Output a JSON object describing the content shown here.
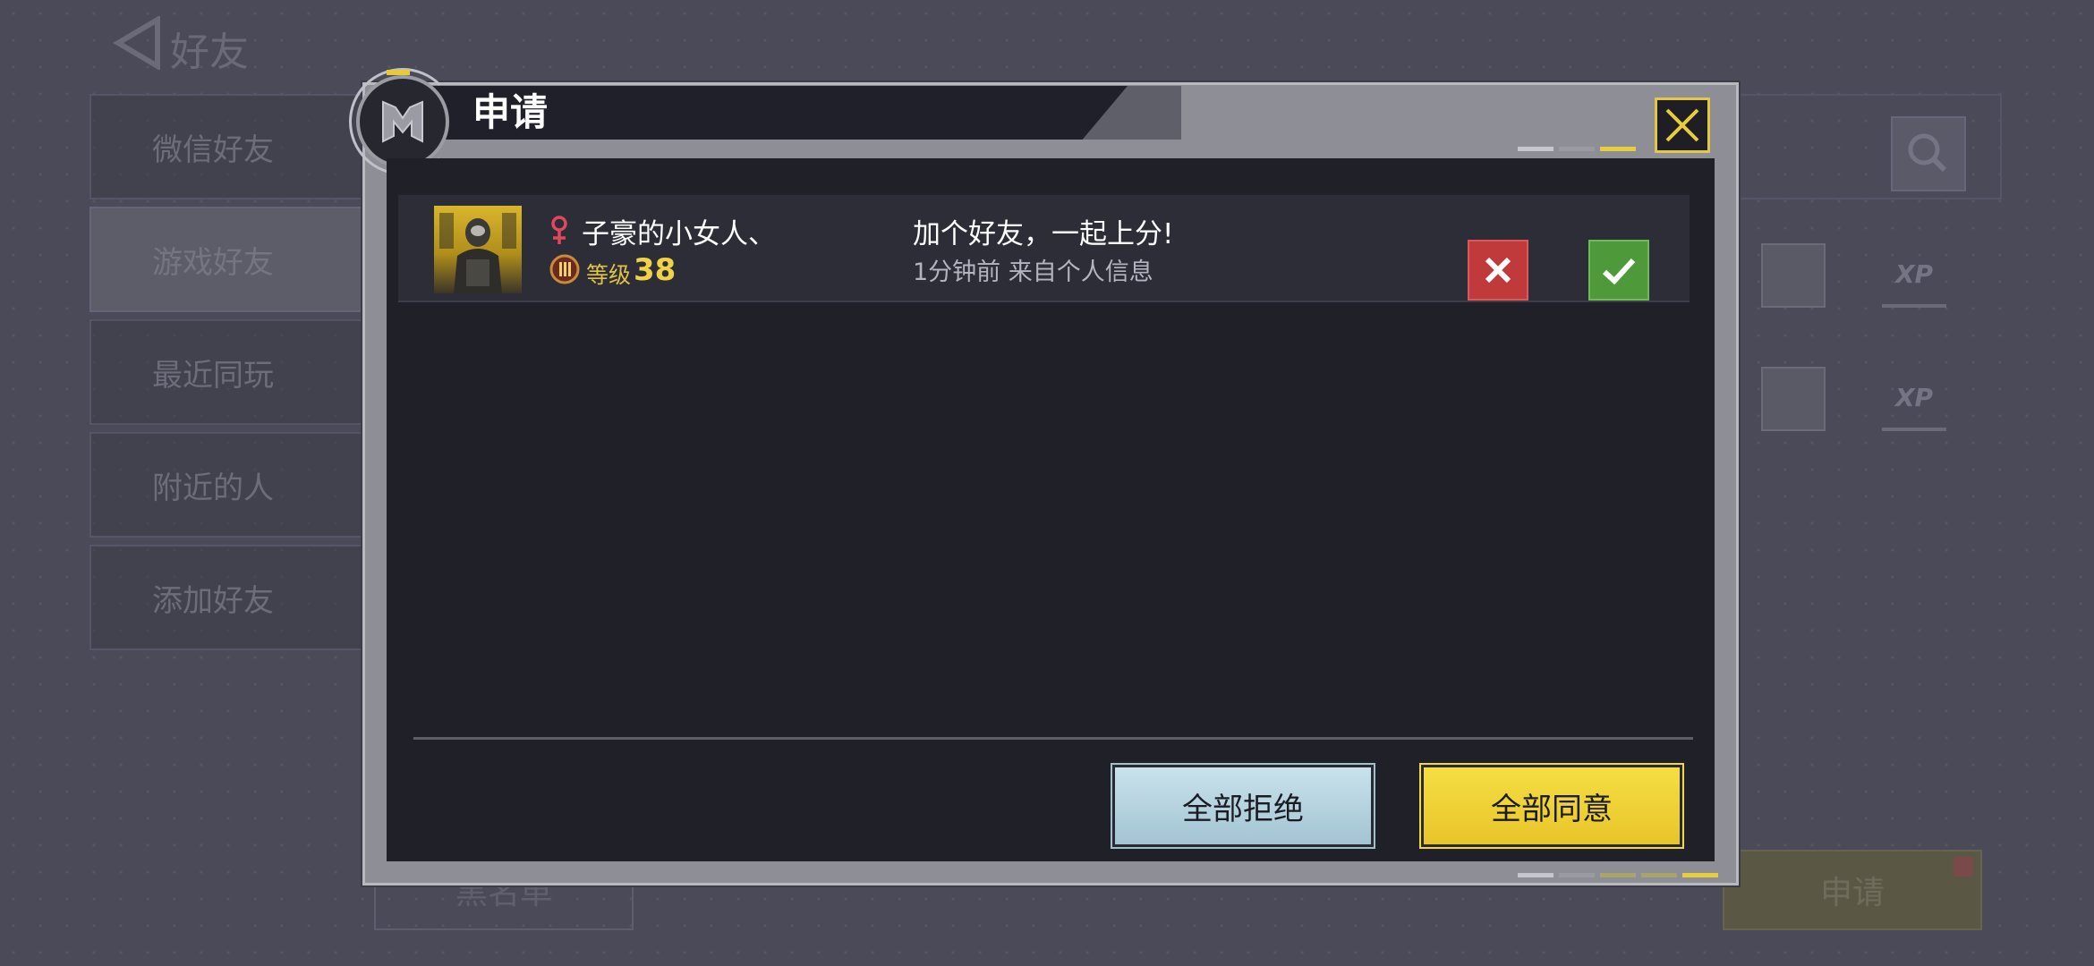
{
  "background": {
    "title": "好友",
    "side_tabs": [
      "微信好友",
      "游戏好友",
      "最近同玩",
      "附近的人",
      "添加好友"
    ],
    "blacklist_label": "黑名单",
    "apply_label": "申请"
  },
  "modal": {
    "title": "申请",
    "request": {
      "player_name": "子豪的小女人、",
      "level_label": "等级",
      "level_value": "38",
      "message": "加个好友，一起上分!",
      "time_source": "1分钟前 来自个人信息"
    },
    "reject_all_label": "全部拒绝",
    "accept_all_label": "全部同意"
  },
  "colors": {
    "accent_yellow": "#e8cd3d",
    "reject_red": "#c0393b",
    "accept_green": "#4e9a3a",
    "female_pink": "#e0485e"
  },
  "icons": {
    "close": "close-icon",
    "reject": "x-icon",
    "accept": "check-icon",
    "gender": "female-icon",
    "rank": "rank-badge-icon",
    "search": "search-icon",
    "back": "back-arrow-icon"
  }
}
